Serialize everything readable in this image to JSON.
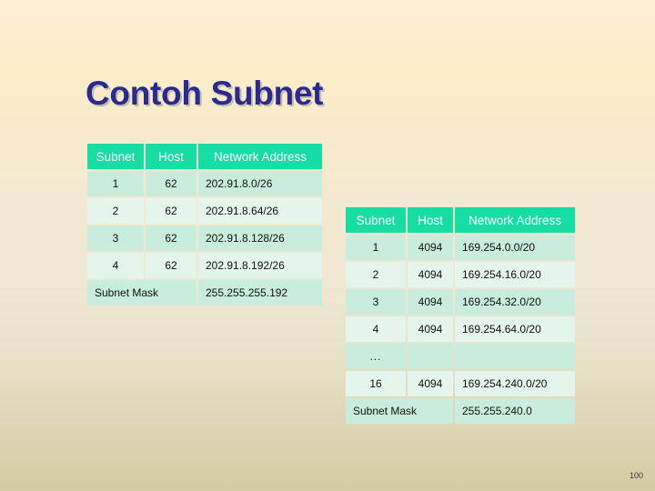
{
  "slide": {
    "title": "Contoh Subnet",
    "page_number": "100",
    "title_color": "#2b2b8f",
    "header_color": "#16dea2",
    "row_dark_color": "#c9eddc",
    "row_light_color": "#e4f6ec",
    "background_top_color": "#fdf0d4",
    "background_bottom_color": "#d4caa3"
  },
  "table1": {
    "headers": [
      "Subnet",
      "Host",
      "Network Address"
    ],
    "rows": [
      {
        "subnet": "1",
        "host": "62",
        "network": "202.91.8.0/26"
      },
      {
        "subnet": "2",
        "host": "62",
        "network": "202.91.8.64/26"
      },
      {
        "subnet": "3",
        "host": "62",
        "network": "202.91.8.128/26"
      },
      {
        "subnet": "4",
        "host": "62",
        "network": "202.91.8.192/26"
      }
    ],
    "mask_label": "Subnet Mask",
    "mask_value": "255.255.255.192"
  },
  "table2": {
    "headers": [
      "Subnet",
      "Host",
      "Network Address"
    ],
    "rows": [
      {
        "subnet": "1",
        "host": "4094",
        "network": "169.254.0.0/20"
      },
      {
        "subnet": "2",
        "host": "4094",
        "network": "169.254.16.0/20"
      },
      {
        "subnet": "3",
        "host": "4094",
        "network": "169.254.32.0/20"
      },
      {
        "subnet": "4",
        "host": "4094",
        "network": "169.254.64.0/20"
      },
      {
        "subnet": "...",
        "host": "",
        "network": ""
      },
      {
        "subnet": "16",
        "host": "4094",
        "network": "169.254.240.0/20"
      }
    ],
    "mask_label": "Subnet Mask",
    "mask_value": "255.255.240.0"
  }
}
